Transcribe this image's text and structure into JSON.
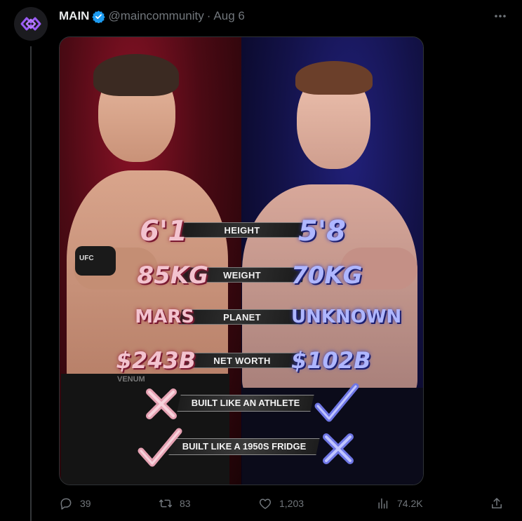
{
  "tweet": {
    "author_name": "MAIN",
    "handle": "@maincommunity",
    "separator": "·",
    "date": "Aug 6"
  },
  "image": {
    "rows": [
      {
        "left": "6'1",
        "label": "HEIGHT",
        "right": "5'8"
      },
      {
        "left": "85KG",
        "label": "WEIGHT",
        "right": "70KG"
      },
      {
        "left": "MARS",
        "label": "PLANET",
        "right": "UNKNOWN"
      },
      {
        "left": "$243B",
        "label": "NET WORTH",
        "right": "$102B"
      }
    ],
    "comparisons": [
      {
        "label": "BUILT LIKE AN ATHLETE",
        "left_mark": "cross",
        "right_mark": "check"
      },
      {
        "label": "BUILT LIKE A 1950S FRIDGE",
        "left_mark": "check",
        "right_mark": "cross"
      }
    ],
    "shorts_text": "VENUM",
    "glove_text": "UFC"
  },
  "actions": {
    "replies": "39",
    "reposts": "83",
    "likes": "1,203",
    "views": "74.2K"
  },
  "colors": {
    "verified": "#1d9bf0",
    "left_theme": "#8a1226",
    "right_theme": "#21207a",
    "muted": "#71767b"
  },
  "icons": [
    "logo-icon",
    "verified-badge-icon",
    "more-icon",
    "reply-icon",
    "repost-icon",
    "like-icon",
    "views-icon",
    "share-icon",
    "cross-icon",
    "check-icon"
  ]
}
